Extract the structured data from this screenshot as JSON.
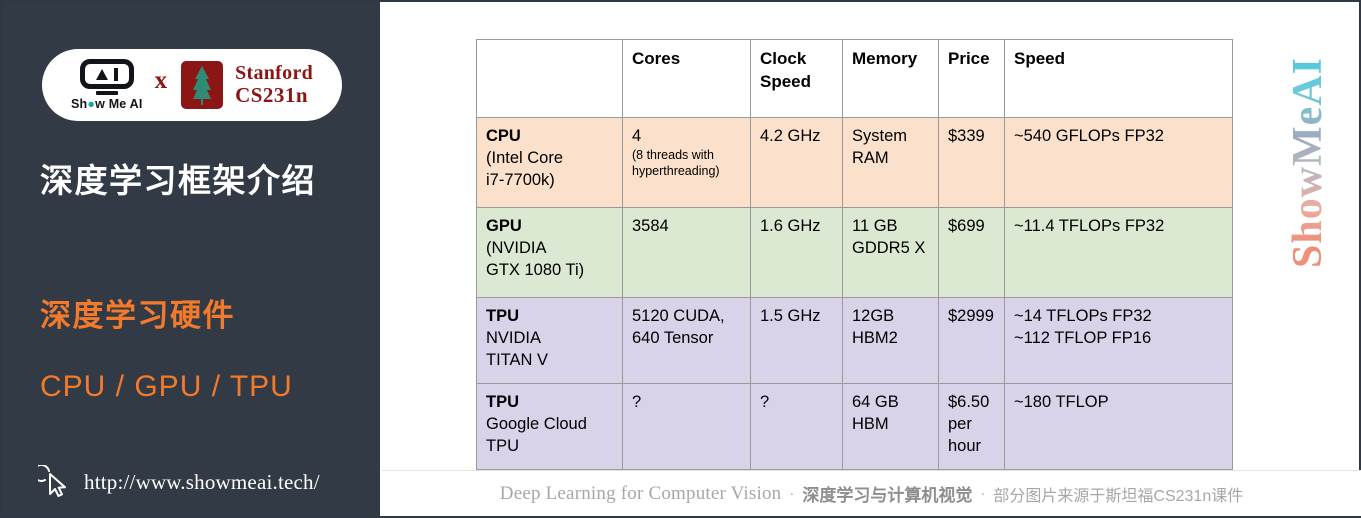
{
  "sidebar": {
    "logo": {
      "showmeai_text": "Show Me AI",
      "x_label": "x",
      "stanford_line1": "Stanford",
      "stanford_line2": "CS231n",
      "stanford_icon": "stanford-tree-s-icon",
      "showmeai_icon": "showmeai-robot-icon"
    },
    "title": "深度学习框架介绍",
    "subtitle": "深度学习硬件",
    "subtitle2": "CPU / GPU / TPU",
    "url": "http://www.showmeai.tech/",
    "cursor_icon": "click-cursor-icon",
    "bg_color": "#313a45",
    "accent_color": "#f3792b"
  },
  "table": {
    "headers": [
      "",
      "Cores",
      "Clock Speed",
      "Memory",
      "Price",
      "Speed"
    ],
    "rows": [
      {
        "device_name": "CPU",
        "device_detail": "(Intel Core\ni7-7700k)",
        "cores": "4",
        "cores_note": "(8 threads with hyperthreading)",
        "clock_speed": "4.2 GHz",
        "memory": "System RAM",
        "price": "$339",
        "speed": "~540 GFLOPs FP32",
        "row_color": "#fbe1cb"
      },
      {
        "device_name": "GPU",
        "device_detail": "(NVIDIA\nGTX 1080 Ti)",
        "cores": "3584",
        "cores_note": "",
        "clock_speed": "1.6 GHz",
        "memory": "11 GB GDDR5 X",
        "price": "$699",
        "speed": "~11.4 TFLOPs FP32",
        "row_color": "#dbe8d2"
      },
      {
        "device_name": "TPU",
        "device_detail": "NVIDIA\nTITAN V",
        "cores": "5120 CUDA,\n640 Tensor",
        "cores_note": "",
        "clock_speed": "1.5 GHz",
        "memory": "12GB HBM2",
        "price": "$2999",
        "speed": "~14 TFLOPs FP32\n~112 TFLOP FP16",
        "row_color": "#d9d2e9"
      },
      {
        "device_name": "TPU",
        "device_detail": "Google Cloud\nTPU",
        "cores": "?",
        "cores_note": "",
        "clock_speed": "?",
        "memory": "64 GB HBM",
        "price": "$6.50 per hour",
        "speed": "~180 TFLOP",
        "row_color": "#d9d2e9"
      }
    ]
  },
  "watermark": {
    "text": "ShowMeAI"
  },
  "footer": {
    "english": "Deep Learning for Computer Vision",
    "separator1": "·",
    "chinese_bold": "深度学习与计算机视觉",
    "separator2": "·",
    "chinese_small": "部分图片来源于斯坦福CS231n课件"
  }
}
